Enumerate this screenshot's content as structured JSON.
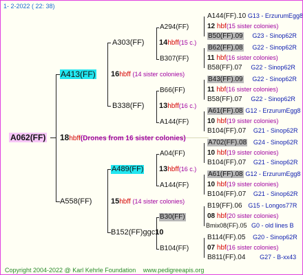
{
  "header": "1-  2-2022 ( 22: 38)",
  "root": {
    "name": "A062(FF)"
  },
  "gen1": {
    "num": "18",
    "hb": "hbff",
    "note": "(Drones from 16 sister colonies)"
  },
  "top": {
    "name": "A413(FF)",
    "num": "16",
    "hb": "hbff",
    "note": "(14 sister colonies)"
  },
  "bottom": {
    "name": "A558(FF)",
    "num": "15",
    "hb": "hbff",
    "note": "(14 sister colonies)"
  },
  "a303": {
    "name": "A303(FF)",
    "num": "14",
    "hb": "hbff",
    "note": "(15 c.)"
  },
  "b338": {
    "name": "B338(FF)",
    "num": "13",
    "hb": "hbff",
    "note": "(16 c.)"
  },
  "a489": {
    "name": "A489(FF)",
    "num": "13",
    "hb": "hbff",
    "note": "(16 c.)"
  },
  "b152": {
    "name": "B152(FF)ggc",
    "num": "10"
  },
  "g3": {
    "a294": "A294(FF)",
    "b307": "B307(FF)",
    "b66": "B66(FF)",
    "a144a": "A144(FF)",
    "a04": "A04(FF)",
    "a144b": "A144(FF)",
    "b30": "B30(FF)",
    "b104": "B104(FF)"
  },
  "rows": [
    {
      "left": "A144(FF).10",
      "right": "G13 - ErzurumEgg8"
    },
    {
      "num": "12",
      "hb": "hbf",
      "note": "(15 sister colonies)"
    },
    {
      "left": "B50(FF).09",
      "right": "G23 - Sinop62R"
    },
    {
      "left": "B62(FF).08",
      "right": "G22 - Sinop62R"
    },
    {
      "num": "11",
      "hb": "hbf",
      "note": "(16 sister colonies)"
    },
    {
      "left": "B58(FF).07",
      "right": "G22 - Sinop62R"
    },
    {
      "left": "B43(FF).09",
      "right": "G22 - Sinop62R"
    },
    {
      "num": "11",
      "hb": "hbf",
      "note": "(16 sister colonies)"
    },
    {
      "left": "B58(FF).07",
      "right": "G22 - Sinop62R"
    },
    {
      "left": "A61(FF).08",
      "right": "G12 - ErzurumEgg8"
    },
    {
      "num": "10",
      "hb": "hbf",
      "note": "(19 sister colonies)"
    },
    {
      "left": "B104(FF).07",
      "right": "G21 - Sinop62R"
    },
    {
      "left": "A702(FF).08",
      "right": "G24 - Sinop62R"
    },
    {
      "num": "10",
      "hb": "hbf",
      "note": "(19 sister colonies)"
    },
    {
      "left": "B104(FF).07",
      "right": "G21 - Sinop62R"
    },
    {
      "left": "A61(FF).08",
      "right": "G12 - ErzurumEgg8"
    },
    {
      "num": "10",
      "hb": "hbf",
      "note": "(19 sister colonies)"
    },
    {
      "left": "B104(FF).07",
      "right": "G21 - Sinop62R"
    },
    {
      "left": "B19(FF).06",
      "right": "G15 - Longos77R"
    },
    {
      "num": "08",
      "hb": "hbf",
      "note": "(20 sister colonies)"
    },
    {
      "left": "Bmix08(FF).05",
      "right": "G0 - old lines B"
    },
    {
      "left": "B114(FF).05",
      "right": "G20 - Sinop62R"
    },
    {
      "num": "07",
      "hb": "hbf",
      "note": "(16 sister colonies)"
    },
    {
      "left": "B811(FF).04",
      "right": "G27 - B-xx43"
    }
  ],
  "footer": {
    "copyright": "Copyright 2004-2022 @ Karl Kehrle Foundation",
    "site": "www.pedigreeapis.org"
  }
}
